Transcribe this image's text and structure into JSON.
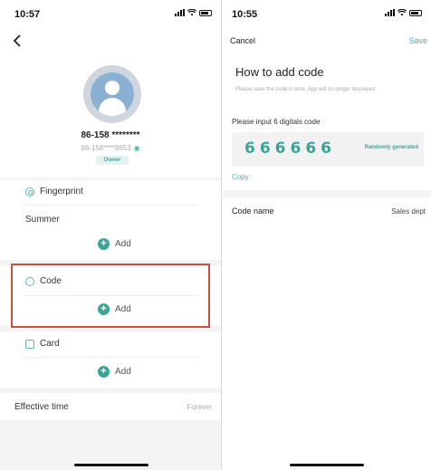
{
  "left": {
    "status_time": "10:57",
    "profile": {
      "name": "86-158 ********",
      "sub": "86-158****8653",
      "badge": "Owner"
    },
    "fingerprint_label": "Fingerprint",
    "fingerprint_item": "Summer",
    "code_label": "Code",
    "card_label": "Card",
    "add_label": "Add",
    "effective_time_label": "Effective time",
    "effective_time_value": "Forever",
    "highlight_color": "#c7533c"
  },
  "right": {
    "status_time": "10:55",
    "cancel_label": "Cancel",
    "save_label": "Save",
    "title": "How to add code",
    "hint": "Please save the code in time, App will no longer displayed",
    "input_label": "Please input 6 digitals code",
    "code_value": "666666",
    "randomly_label": "Randomly generated",
    "copy_label": "Copy",
    "code_name_label": "Code name",
    "code_name_value": "Sales dept"
  },
  "colors": {
    "accent": "#3aa596",
    "background": "#f4f4f4"
  },
  "icons": {
    "back": "chevron-left-icon",
    "fingerprint": "fingerprint-icon",
    "code": "code-icon",
    "card": "card-icon",
    "add": "plus-circle-icon",
    "eye": "eye-icon",
    "avatar": "user-avatar-icon"
  }
}
